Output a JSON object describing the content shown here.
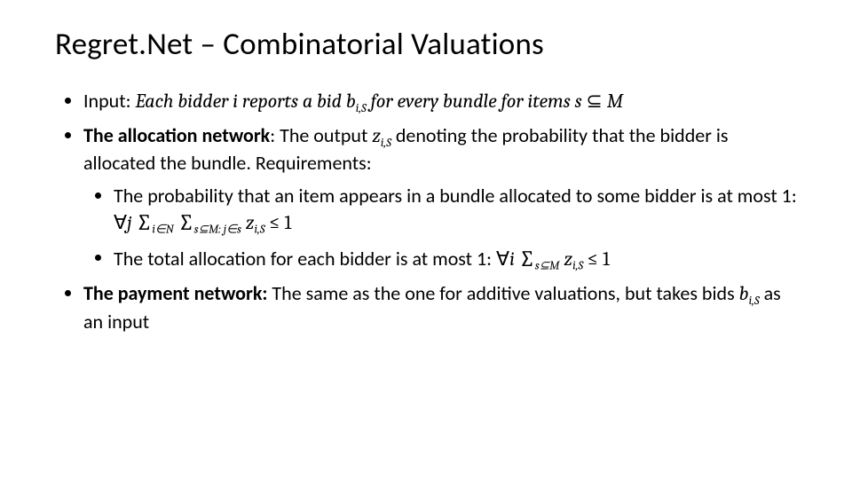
{
  "title": "Regret.Net – Combinatorial Valuations",
  "b1": {
    "pre": "Input: ",
    "t1": "Each bidder i reports a bid ",
    "m1v": "b",
    "m1s": "i,S",
    "t2": " for every bundle for items ",
    "m2v": "s",
    "t3": " ⊆ ",
    "m3v": "M"
  },
  "b2": {
    "bold": "The allocation network",
    "t1": ": The output ",
    "m1v": "z",
    "m1s": "i,S",
    "t2": " denoting the probability that the bidder is allocated the bundle. Requirements:"
  },
  "b2a": {
    "t1": "The probability that an item appears in a bundle allocated to some bidder is at most 1: ",
    "forall": "∀",
    "j": "j",
    "sp1": "  ",
    "sum1": "∑",
    "s1sub": "i∈N",
    "sp2": " ",
    "sum2": "∑",
    "s2sub": "s⊆M: j∈s",
    "sp3": " ",
    "zv": "z",
    "zs": "i,S",
    "tail": " ≤ 1"
  },
  "b2b": {
    "t1": "The total allocation for each bidder is at most 1: ",
    "forall": "∀",
    "i": "i",
    "sp1": " ",
    "sum1": "∑",
    "s1sub": "s⊆M",
    "sp2": " ",
    "zv": "z",
    "zs": "i,S",
    "tail": " ≤ 1"
  },
  "b3": {
    "bold": "The payment network:",
    "t1": " The same as the one for additive valuations, but takes bids ",
    "m1v": "b",
    "m1s": "i,S",
    "t2": " as an input"
  }
}
